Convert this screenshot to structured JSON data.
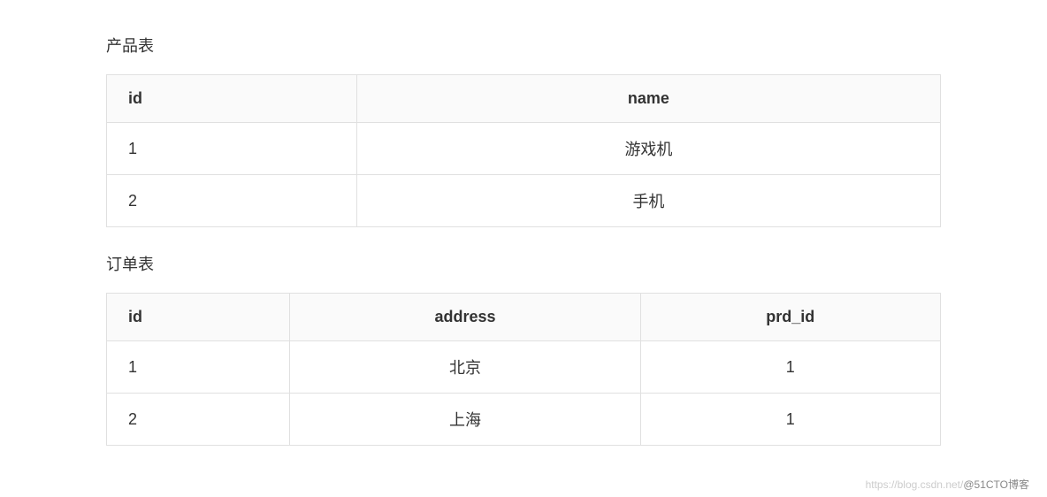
{
  "sections": {
    "product": {
      "title": "产品表",
      "columns": {
        "id": "id",
        "name": "name"
      },
      "rows": [
        {
          "id": "1",
          "name": "游戏机"
        },
        {
          "id": "2",
          "name": "手机"
        }
      ]
    },
    "order": {
      "title": "订单表",
      "columns": {
        "id": "id",
        "address": "address",
        "prd_id": "prd_id"
      },
      "rows": [
        {
          "id": "1",
          "address": "北京",
          "prd_id": "1"
        },
        {
          "id": "2",
          "address": "上海",
          "prd_id": "1"
        }
      ]
    }
  },
  "watermark": {
    "faint": "https://blog.csdn.net/",
    "dark": "@51CTO博客"
  }
}
